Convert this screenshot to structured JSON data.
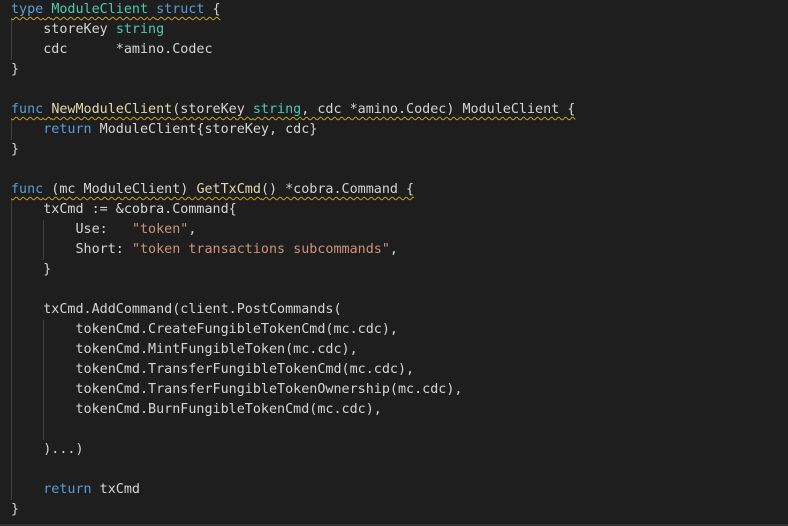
{
  "editor": {
    "lines": [
      [
        {
          "t": "type",
          "c": "kw",
          "w": 1
        },
        {
          "t": " ",
          "c": "pl",
          "w": 1
        },
        {
          "t": "ModuleClient",
          "c": "ty",
          "w": 1
        },
        {
          "t": " ",
          "c": "pl",
          "w": 1
        },
        {
          "t": "struct",
          "c": "kw",
          "w": 1
        },
        {
          "t": " {",
          "c": "pl",
          "w": 1
        }
      ],
      [
        {
          "t": "    storeKey ",
          "c": "pl"
        },
        {
          "t": "string",
          "c": "ty"
        }
      ],
      [
        {
          "t": "    cdc      *amino.Codec",
          "c": "pl"
        }
      ],
      [
        {
          "t": "}",
          "c": "pl"
        }
      ],
      [],
      [
        {
          "t": "func",
          "c": "kw",
          "w": 1
        },
        {
          "t": " ",
          "c": "pl",
          "w": 1
        },
        {
          "t": "NewModuleClient",
          "c": "fn",
          "w": 1
        },
        {
          "t": "(storeKey ",
          "c": "pl",
          "w": 1
        },
        {
          "t": "string",
          "c": "ty",
          "w": 1
        },
        {
          "t": ", cdc *amino.Codec) ModuleClient {",
          "c": "pl",
          "w": 1
        }
      ],
      [
        {
          "t": "    ",
          "c": "pl"
        },
        {
          "t": "return",
          "c": "kw"
        },
        {
          "t": " ModuleClient{storeKey, cdc}",
          "c": "pl"
        }
      ],
      [
        {
          "t": "}",
          "c": "pl"
        }
      ],
      [],
      [
        {
          "t": "func",
          "c": "kw",
          "w": 1
        },
        {
          "t": " (mc ModuleClient) ",
          "c": "pl",
          "w": 1
        },
        {
          "t": "GetTxCmd",
          "c": "fn",
          "w": 1
        },
        {
          "t": "() *cobra.Command {",
          "c": "pl",
          "w": 1
        }
      ],
      [
        {
          "t": "    txCmd := &cobra.Command{",
          "c": "pl"
        }
      ],
      [
        {
          "t": "        Use:   ",
          "c": "pl"
        },
        {
          "t": "\"token\"",
          "c": "str"
        },
        {
          "t": ",",
          "c": "pl"
        }
      ],
      [
        {
          "t": "        Short: ",
          "c": "pl"
        },
        {
          "t": "\"token transactions subcommands\"",
          "c": "str"
        },
        {
          "t": ",",
          "c": "pl"
        }
      ],
      [
        {
          "t": "    }",
          "c": "pl"
        }
      ],
      [],
      [
        {
          "t": "    txCmd.AddCommand(client.PostCommands(",
          "c": "pl"
        }
      ],
      [
        {
          "t": "        tokenCmd.CreateFungibleTokenCmd(mc.cdc),",
          "c": "pl"
        }
      ],
      [
        {
          "t": "        tokenCmd.MintFungibleToken(mc.cdc),",
          "c": "pl"
        }
      ],
      [
        {
          "t": "        tokenCmd.TransferFungibleTokenCmd(mc.cdc),",
          "c": "pl"
        }
      ],
      [
        {
          "t": "        tokenCmd.TransferFungibleTokenOwnership(mc.cdc),",
          "c": "pl"
        }
      ],
      [
        {
          "t": "        tokenCmd.BurnFungibleTokenCmd(mc.cdc),",
          "c": "pl"
        }
      ],
      [],
      [
        {
          "t": "    )...)",
          "c": "pl"
        }
      ],
      [],
      [
        {
          "t": "    ",
          "c": "pl"
        },
        {
          "t": "return",
          "c": "kw"
        },
        {
          "t": " txCmd",
          "c": "pl"
        }
      ],
      [
        {
          "t": "}",
          "c": "pl"
        }
      ]
    ]
  }
}
